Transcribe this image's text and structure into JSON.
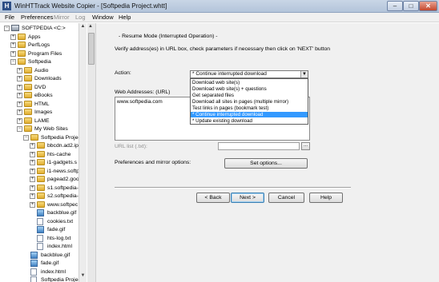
{
  "window": {
    "title": "WinHTTrack Website Copier - [Softpedia Project.whtt]",
    "app_icon": "H"
  },
  "menu": [
    {
      "label": "File",
      "enabled": true
    },
    {
      "label": "Preferences",
      "enabled": true
    },
    {
      "label": "Mirror",
      "enabled": false
    },
    {
      "label": "Log",
      "enabled": false
    },
    {
      "label": "Window",
      "enabled": true
    },
    {
      "label": "Help",
      "enabled": true
    }
  ],
  "tree": {
    "items": [
      {
        "label": "SOFTPEDIA <C:>",
        "icon": "drive-icon"
      },
      {
        "label": "Apps",
        "icon": "folder-icon"
      },
      {
        "label": "PerfLogs",
        "icon": "folder-icon"
      },
      {
        "label": "Program Files",
        "icon": "folder-icon"
      },
      {
        "label": "Softpedia",
        "icon": "folder-icon"
      },
      {
        "label": "Audio",
        "icon": "folder-icon"
      },
      {
        "label": "Downloads",
        "icon": "folder-icon"
      },
      {
        "label": "DVD",
        "icon": "folder-icon"
      },
      {
        "label": "eBooks",
        "icon": "folder-icon"
      },
      {
        "label": "HTML",
        "icon": "folder-icon"
      },
      {
        "label": "Images",
        "icon": "folder-icon"
      },
      {
        "label": "LAME",
        "icon": "folder-icon"
      },
      {
        "label": "My Web Sites",
        "icon": "folder-icon"
      },
      {
        "label": "Softpedia Projec",
        "icon": "folder-icon"
      },
      {
        "label": "bbcdn.ad2.ip",
        "icon": "folder-icon"
      },
      {
        "label": "hts-cache",
        "icon": "folder-icon"
      },
      {
        "label": "i1-gadgets.s",
        "icon": "folder-icon"
      },
      {
        "label": "i1-news.softp",
        "icon": "folder-icon"
      },
      {
        "label": "pagead2.goo",
        "icon": "folder-icon"
      },
      {
        "label": "s1.softpedia-",
        "icon": "folder-icon"
      },
      {
        "label": "s2.softpedia-",
        "icon": "folder-icon"
      },
      {
        "label": "www.softpec",
        "icon": "folder-icon"
      },
      {
        "label": "backblue.gif",
        "icon": "image-file-icon"
      },
      {
        "label": "cookies.txt",
        "icon": "text-file-icon"
      },
      {
        "label": "fade.gif",
        "icon": "image-file-icon"
      },
      {
        "label": "hts-log.txt",
        "icon": "text-file-icon"
      },
      {
        "label": "index.html",
        "icon": "text-file-icon"
      },
      {
        "label": "backblue.gif",
        "icon": "image-file-icon"
      },
      {
        "label": "fade.gif",
        "icon": "image-file-icon"
      },
      {
        "label": "index.html",
        "icon": "text-file-icon"
      },
      {
        "label": "Softpedia Projec",
        "icon": "text-file-icon"
      }
    ]
  },
  "wizard": {
    "section_title": "- Resume Mode (Interrupted Operation) -",
    "instructions": "Verify address(es) in URL box, check parameters if necessary then click on 'NEXT' button",
    "action_label": "Action:",
    "action_selected": "* Continue interrupted download",
    "action_options": [
      "Download web site(s)",
      "Download web site(s) + questions",
      "Get separated files",
      "Download all sites in pages (multiple mirror)",
      "Test links in pages (bookmark test)",
      "* Continue interrupted download",
      "* Update existing download"
    ],
    "action_highlight_index": 5,
    "web_addresses_label": "Web Addresses: (URL)",
    "web_addresses_value": "www.softpedia.com",
    "url_list_label": "URL list (.txt):",
    "url_list_value": "",
    "browse_label": "...",
    "options_label": "Preferences and mirror options:",
    "set_options_label": "Set options...",
    "buttons": {
      "back": "< Back",
      "next": "Next >",
      "cancel": "Cancel",
      "help": "Help"
    }
  }
}
